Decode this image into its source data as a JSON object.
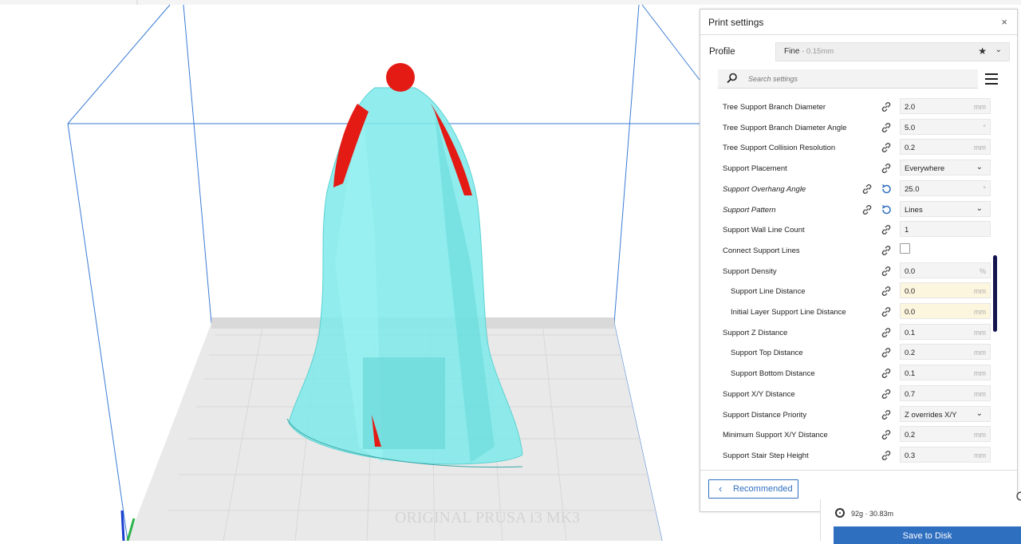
{
  "colors": {
    "accent": "#2f6fc0",
    "model": "#7eeaea",
    "overhang": "#e41b14",
    "warning_field": "#fdf6df",
    "scrollbar": "#14144e"
  },
  "panel": {
    "title": "Print settings",
    "close_glyph": "×",
    "profile_label": "Profile",
    "profile_name": "Fine",
    "profile_sub": " - 0.15mm",
    "search_placeholder": "Search settings",
    "recommended_label": "Recommended"
  },
  "settings": [
    {
      "label": "Tree Support Branch Diameter",
      "value": "2.0",
      "unit": "mm"
    },
    {
      "label": "Tree Support Branch Diameter Angle",
      "value": "5.0",
      "unit": "°"
    },
    {
      "label": "Tree Support Collision Resolution",
      "value": "0.2",
      "unit": "mm"
    },
    {
      "label": "Support Placement",
      "value": "Everywhere",
      "type": "select"
    },
    {
      "label": "Support Overhang Angle",
      "value": "25.0",
      "unit": "°",
      "modified": true
    },
    {
      "label": "Support Pattern",
      "value": "Lines",
      "type": "select",
      "modified": true
    },
    {
      "label": "Support Wall Line Count",
      "value": "1",
      "unit": ""
    },
    {
      "label": "Connect Support Lines",
      "type": "checkbox",
      "checked": false
    },
    {
      "label": "Support Density",
      "value": "0.0",
      "unit": "%"
    },
    {
      "label": "Support Line Distance",
      "value": "0.0",
      "unit": "mm",
      "sub": true,
      "warn": true
    },
    {
      "label": "Initial Layer Support Line Distance",
      "value": "0.0",
      "unit": "mm",
      "sub": true,
      "warn": true
    },
    {
      "label": "Support Z Distance",
      "value": "0.1",
      "unit": "mm"
    },
    {
      "label": "Support Top Distance",
      "value": "0.2",
      "unit": "mm",
      "sub": true
    },
    {
      "label": "Support Bottom Distance",
      "value": "0.1",
      "unit": "mm",
      "sub": true
    },
    {
      "label": "Support X/Y Distance",
      "value": "0.7",
      "unit": "mm"
    },
    {
      "label": "Support Distance Priority",
      "value": "Z overrides X/Y",
      "type": "select"
    },
    {
      "label": "Minimum Support X/Y Distance",
      "value": "0.2",
      "unit": "mm"
    },
    {
      "label": "Support Stair Step Height",
      "value": "0.3",
      "unit": "mm"
    }
  ],
  "estimate": {
    "text": "92g · 30.83m"
  },
  "save_button": "Save to Disk"
}
